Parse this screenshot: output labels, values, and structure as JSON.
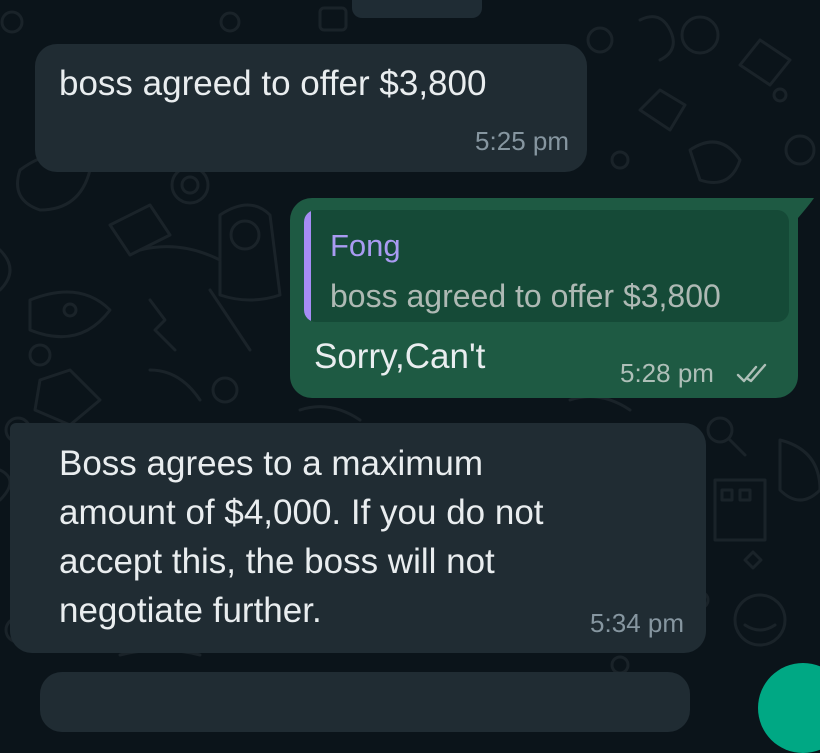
{
  "chat": {
    "messages": [
      {
        "direction": "incoming",
        "text": "boss agreed to offer $3,800",
        "time": "5:25 pm"
      },
      {
        "direction": "outgoing",
        "quoted_author": "Fong",
        "quoted_text": "boss agreed to offer $3,800",
        "text": "Sorry,Can't",
        "time": "5:28 pm",
        "status_icon": "double-check-read-icon"
      },
      {
        "direction": "incoming",
        "lines": [
          "Boss agrees to a maximum",
          "amount of $4,000. If you do not",
          "accept this, the boss will not",
          "negotiate further."
        ],
        "time": "5:34 pm"
      }
    ]
  },
  "colors": {
    "background": "#0b141a",
    "incoming_bubble": "#202c33",
    "outgoing_bubble": "#1e5a43",
    "quote_accent": "#a68cf5",
    "fab": "#00a884"
  }
}
